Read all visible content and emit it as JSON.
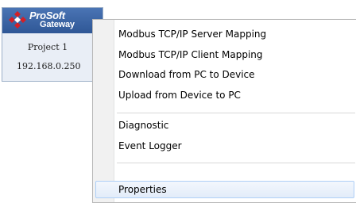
{
  "device_card": {
    "brand_line1": "ProSoft",
    "brand_line2": "Gateway",
    "project_name": "Project 1",
    "ip_address": "192.168.0.250"
  },
  "context_menu": {
    "items": [
      "Modbus TCP/IP Server Mapping",
      "Modbus TCP/IP Client Mapping",
      "Download from PC to Device",
      "Upload from Device to PC",
      "Diagnostic",
      "Event Logger",
      "Properties"
    ],
    "highlighted_item": "Properties"
  },
  "colors": {
    "brand_red": "#d32027",
    "header_blue": "#3a64a6",
    "highlight_border": "#aecff7"
  }
}
